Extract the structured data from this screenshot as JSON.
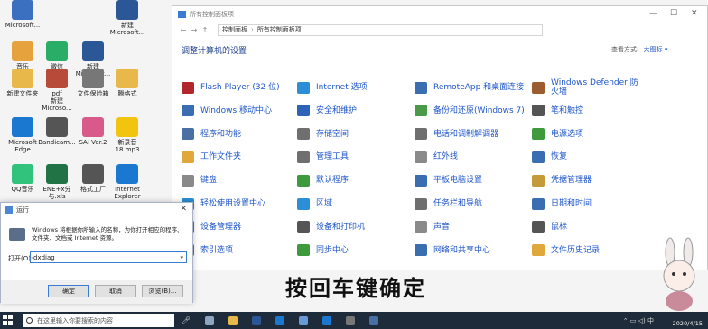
{
  "desktop": {
    "icons": [
      {
        "label": "Microsoft...",
        "color": "#3b70c0"
      },
      {
        "label": "音乐",
        "color": "#e6a23c"
      },
      {
        "label": "微信",
        "color": "#2aae67"
      },
      {
        "label": "新建\nMicrosoft...",
        "color": "#2b5797"
      },
      {
        "label": "新建\nMicrosoft...",
        "color": "#2b5797"
      },
      {
        "label": "新建文件夹",
        "color": "#e8b84a"
      },
      {
        "label": "pdf\n新建\nMicroso...",
        "color": "#b84a3a"
      },
      {
        "label": "文件保险箱",
        "color": "#777777"
      },
      {
        "label": "腾格式",
        "color": "#e8b84a"
      },
      {
        "label": "Microsoft\nEdge",
        "color": "#1b78d0"
      },
      {
        "label": "Bandicam...",
        "color": "#555555"
      },
      {
        "label": "SAI Ver.2",
        "color": "#d85a8a"
      },
      {
        "label": "新录音\n18.mp3",
        "color": "#f1c40f"
      },
      {
        "label": "QQ音乐",
        "color": "#31c27c"
      },
      {
        "label": "ENE+x分\n与.xls",
        "color": "#217346"
      },
      {
        "label": "格式工厂",
        "color": "#555555"
      },
      {
        "label": "Internet\nExplorer",
        "color": "#1b78d0"
      }
    ]
  },
  "control_panel": {
    "window_title": "所有控制面板项",
    "breadcrumb": [
      "控制面板",
      "所有控制面板项"
    ],
    "heading": "调整计算机的设置",
    "view_by_label": "查看方式:",
    "view_by_value": "大图标 ▾",
    "items": [
      {
        "label": "Flash Player (32 位)",
        "color": "#b1272b"
      },
      {
        "label": "Internet 选项",
        "color": "#2a8fd6"
      },
      {
        "label": "RemoteApp 和桌面连接",
        "color": "#3a6eb0"
      },
      {
        "label": "Windows Defender 防火墙",
        "color": "#9a5b2d"
      },
      {
        "label": "Windows 移动中心",
        "color": "#3a6eb0"
      },
      {
        "label": "安全和维护",
        "color": "#2d63b8"
      },
      {
        "label": "备份和还原(Windows 7)",
        "color": "#4a9a4a"
      },
      {
        "label": "笔和触控",
        "color": "#555555"
      },
      {
        "label": "程序和功能",
        "color": "#4a6fa5"
      },
      {
        "label": "存储空间",
        "color": "#6f6f6f"
      },
      {
        "label": "电话和调制解调器",
        "color": "#6f6f6f"
      },
      {
        "label": "电源选项",
        "color": "#3d9a3d"
      },
      {
        "label": "工作文件夹",
        "color": "#e0a83a"
      },
      {
        "label": "管理工具",
        "color": "#6f6f6f"
      },
      {
        "label": "红外线",
        "color": "#8a8a8a"
      },
      {
        "label": "恢复",
        "color": "#3a6eb0"
      },
      {
        "label": "键盘",
        "color": "#8a8a8a"
      },
      {
        "label": "默认程序",
        "color": "#3d9a3d"
      },
      {
        "label": "平板电脑设置",
        "color": "#3a6eb0"
      },
      {
        "label": "凭据管理器",
        "color": "#c49a3a"
      },
      {
        "label": "轻松使用设置中心",
        "color": "#2a8fd6"
      },
      {
        "label": "区域",
        "color": "#2a8fd6"
      },
      {
        "label": "任务栏和导航",
        "color": "#6f6f6f"
      },
      {
        "label": "日期和时间",
        "color": "#3a6eb0"
      },
      {
        "label": "设备管理器",
        "color": "#6f6f6f"
      },
      {
        "label": "设备和打印机",
        "color": "#555555"
      },
      {
        "label": "声音",
        "color": "#8a8a8a"
      },
      {
        "label": "鼠标",
        "color": "#555555"
      },
      {
        "label": "索引选项",
        "color": "#6f6f6f"
      },
      {
        "label": "同步中心",
        "color": "#3d9a3d"
      },
      {
        "label": "网络和共享中心",
        "color": "#3a6eb0"
      },
      {
        "label": "文件历史记录",
        "color": "#e0a83a"
      }
    ]
  },
  "run_dialog": {
    "title": "运行",
    "close": "✕",
    "description": "Windows 将根据你所输入的名称，为你打开相应的程序、文件夹、文档或 Internet 资源。",
    "open_label": "打开(O):",
    "input_value": "dxdiag",
    "ok_label": "确定",
    "cancel_label": "取消",
    "browse_label": "浏览(B)..."
  },
  "caption": "按回车键确定",
  "taskbar": {
    "search_placeholder": "在这里输入你要搜索的内容",
    "date": "2020/4/15",
    "ime": "中"
  }
}
